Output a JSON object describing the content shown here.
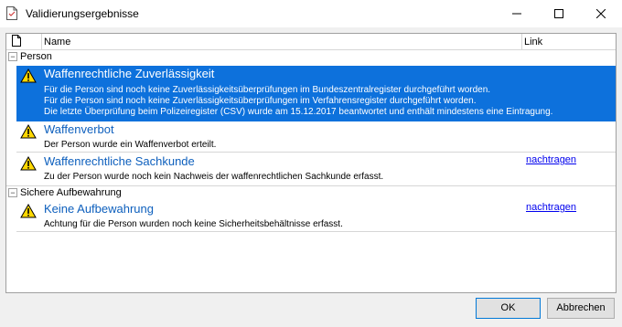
{
  "window": {
    "title": "Validierungsergebnisse",
    "icons": {
      "app": "document-icon",
      "minimize": "minimize-icon",
      "maximize": "maximize-icon",
      "close": "close-icon"
    }
  },
  "list": {
    "columns": {
      "name": "Name",
      "link": "Link"
    },
    "groups": [
      {
        "label": "Person",
        "expander": "−",
        "items": [
          {
            "title": "Waffenrechtliche Zuverlässigkeit",
            "lines": [
              "Für die Person sind noch keine Zuverlässigkeitsüberprüfungen im Bundeszentralregister durchgeführt worden.",
              "Für die Person sind noch keine Zuverlässigkeitsüberprüfungen im Verfahrensregister durchgeführt worden.",
              "Die letzte Überprüfung beim Polizeiregister (CSV) wurde am 15.12.2017 beantwortet und enthält mindestens eine Eintragung."
            ],
            "link": ""
          },
          {
            "title": "Waffenverbot",
            "lines": [
              "Der Person wurde ein Waffenverbot erteilt."
            ],
            "link": ""
          },
          {
            "title": "Waffenrechtliche Sachkunde",
            "lines": [
              "Zu der Person wurde noch kein Nachweis der waffenrechtlichen Sachkunde erfasst."
            ],
            "link": "nachtragen"
          }
        ]
      },
      {
        "label": "Sichere Aufbewahrung",
        "expander": "−",
        "items": [
          {
            "title": "Keine Aufbewahrung",
            "lines": [
              "Achtung für die Person wurden noch keine Sicherheitsbehältnisse erfasst."
            ],
            "link": "nachtragen"
          }
        ]
      }
    ]
  },
  "buttons": {
    "ok": "OK",
    "cancel": "Abbrechen"
  },
  "colors": {
    "selection": "#0d71dc",
    "link": "#0000ee",
    "title": "#0d5fbd",
    "warning": "#ffd800"
  }
}
